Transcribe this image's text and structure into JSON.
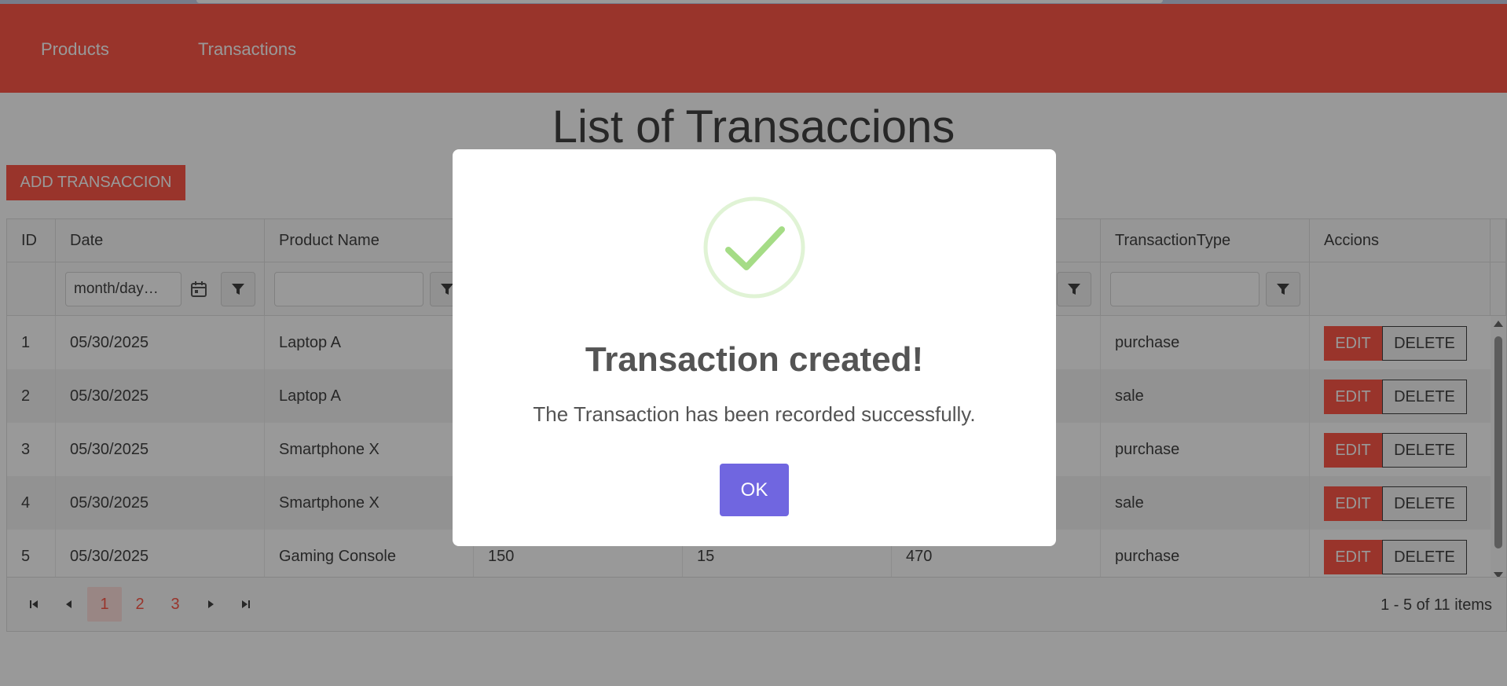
{
  "nav": {
    "products": "Products",
    "transactions": "Transactions"
  },
  "page": {
    "title": "List of Transaccions",
    "add_button": "ADD TRANSACCION"
  },
  "grid": {
    "columns": [
      "ID",
      "Date",
      "Product Name",
      "",
      "",
      "",
      "TransactionType",
      "Accions"
    ],
    "date_filter_placeholder": "month/day…",
    "rows": [
      {
        "id": "1",
        "date": "05/30/2025",
        "product": "Laptop A",
        "c4": "",
        "c5": "",
        "c6": "",
        "type": "purchase"
      },
      {
        "id": "2",
        "date": "05/30/2025",
        "product": "Laptop A",
        "c4": "",
        "c5": "",
        "c6": "",
        "type": "sale"
      },
      {
        "id": "3",
        "date": "05/30/2025",
        "product": "Smartphone X",
        "c4": "",
        "c5": "",
        "c6": "",
        "type": "purchase"
      },
      {
        "id": "4",
        "date": "05/30/2025",
        "product": "Smartphone X",
        "c4": "",
        "c5": "",
        "c6": "",
        "type": "sale"
      },
      {
        "id": "5",
        "date": "05/30/2025",
        "product": "Gaming Console",
        "c4": "150",
        "c5": "15",
        "c6": "470",
        "type": "purchase"
      }
    ],
    "edit_label": "EDIT",
    "delete_label": "DELETE"
  },
  "pager": {
    "pages": [
      "1",
      "2",
      "3"
    ],
    "active_page": "1",
    "info": "1 - 5 of 11 items"
  },
  "modal": {
    "title": "Transaction created!",
    "text": "The Transaction has been recorded successfully.",
    "ok_label": "OK"
  },
  "colors": {
    "accent": "#ff5848",
    "confirm": "#7066e0",
    "success": "#a5dc86"
  }
}
